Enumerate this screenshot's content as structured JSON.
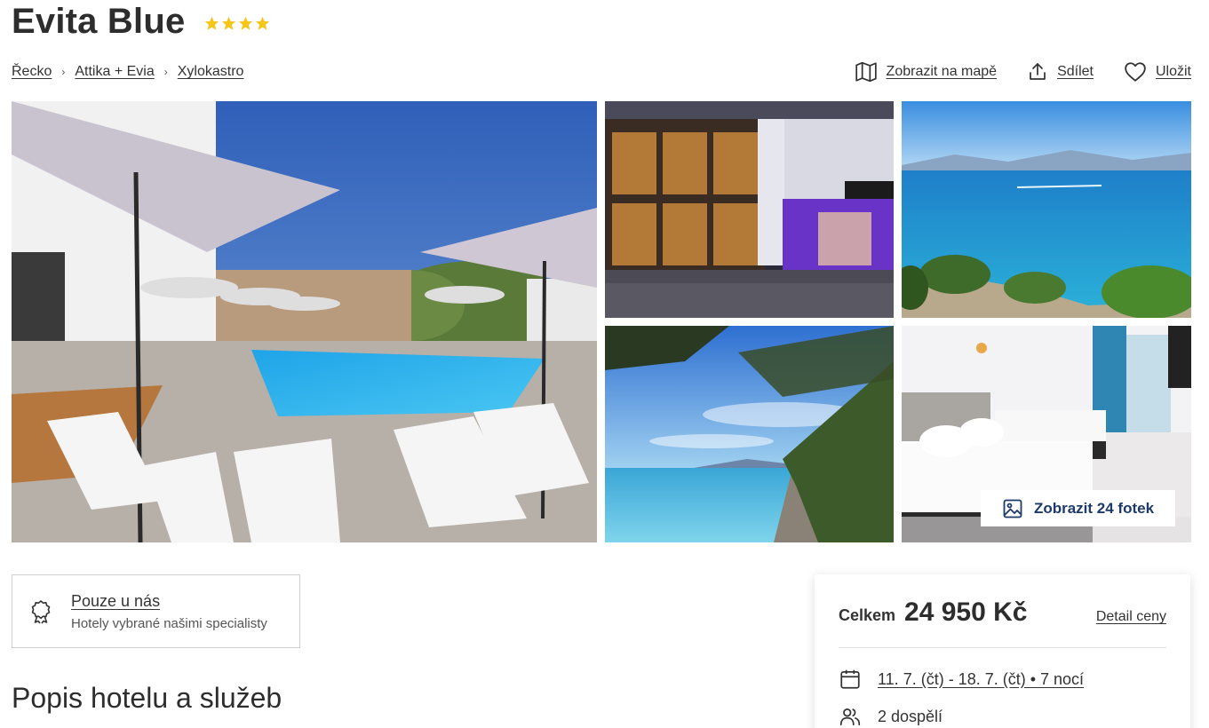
{
  "hotel": {
    "name": "Evita Blue",
    "stars": 4
  },
  "breadcrumb": [
    "Řecko",
    "Attika + Evia",
    "Xylokastro"
  ],
  "actions": {
    "map": "Zobrazit na mapě",
    "share": "Sdílet",
    "save": "Uložit"
  },
  "gallery": {
    "show_photos": "Zobrazit 24 fotek"
  },
  "exclusive": {
    "title": "Pouze u nás",
    "subtitle": "Hotely vybrané našimi specialisty"
  },
  "section": {
    "title": "Popis hotelu a služeb"
  },
  "price": {
    "label": "Celkem",
    "value": "24 950 Kč",
    "detail": "Detail ceny",
    "dates": "11. 7. (čt) - 18. 7. (čt) • 7 nocí",
    "guests": "2 dospělí"
  },
  "colors": {
    "star": "#f5c518",
    "button_text": "#1d3a6b",
    "text": "#333333"
  }
}
